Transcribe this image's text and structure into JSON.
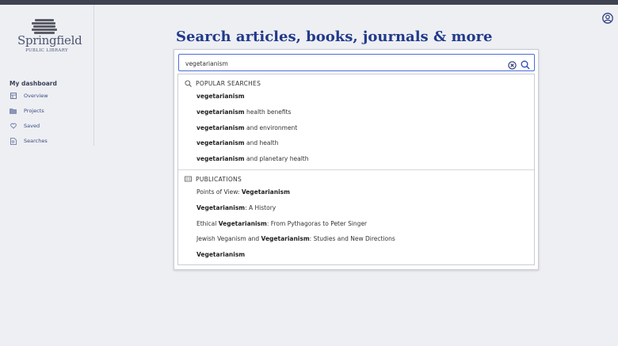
{
  "library": {
    "name": "Springfield",
    "subtitle": "PUBLIC LIBRARY"
  },
  "sidebar": {
    "heading": "My dashboard",
    "items": [
      {
        "label": "Overview",
        "icon": "grid-icon"
      },
      {
        "label": "Projects",
        "icon": "folder-icon"
      },
      {
        "label": "Saved",
        "icon": "heart-icon"
      },
      {
        "label": "Searches",
        "icon": "document-search-icon"
      }
    ]
  },
  "header": {
    "title": "Search articles, books, journals & more",
    "account_icon": "account-icon"
  },
  "search": {
    "value": "vegetarianism",
    "clear_icon": "clear-icon",
    "search_icon": "search-icon"
  },
  "suggestions": {
    "popular_title": "POPULAR SEARCHES",
    "popular": [
      {
        "bold": "vegetarianism",
        "rest": ""
      },
      {
        "bold": "vegetarianism",
        "rest": " health benefits"
      },
      {
        "bold": "vegetarianism",
        "rest": " and environment"
      },
      {
        "bold": "vegetarianism",
        "rest": " and health"
      },
      {
        "bold": "vegetarianism",
        "rest": " and planetary health"
      }
    ],
    "publications_title": "PUBLICATIONS",
    "publications": [
      {
        "pre": "Points of View: ",
        "bold": "Vegetarianism",
        "post": ""
      },
      {
        "pre": "",
        "bold": "Vegetarianism",
        "post": ": A History"
      },
      {
        "pre": "Ethical ",
        "bold": "Vegetarianism",
        "post": ": From Pythagoras to Peter Singer"
      },
      {
        "pre": "Jewish Veganism and ",
        "bold": "Vegetarianism",
        "post": ": Studies and New Directions"
      },
      {
        "pre": "",
        "bold": "Vegetarianism",
        "post": ""
      }
    ]
  },
  "colors": {
    "accent": "#213a8a",
    "link": "#3b4a80",
    "background": "#eeeff3",
    "topbar": "#3f4250",
    "focus_border": "#4b6cd6"
  }
}
